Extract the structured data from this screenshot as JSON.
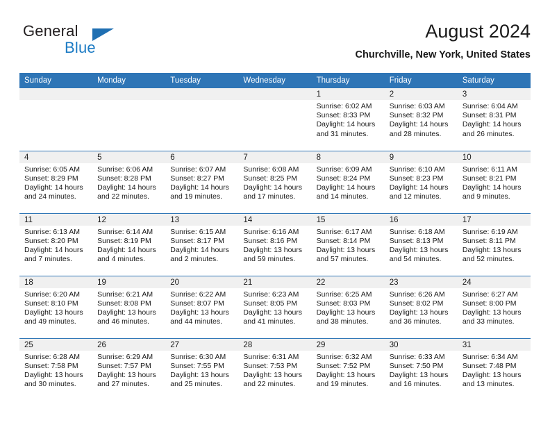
{
  "brand": {
    "name_part1": "General",
    "name_part2": "Blue",
    "accent_color": "#1c7bc4",
    "triangle_color": "#1f6fb2"
  },
  "header": {
    "title": "August 2024",
    "location": "Churchville, New York, United States"
  },
  "theme": {
    "header_blue": "#2e75b6",
    "daynum_band": "#f0f0f0",
    "text": "#1a1a1a"
  },
  "weekdays": [
    "Sunday",
    "Monday",
    "Tuesday",
    "Wednesday",
    "Thursday",
    "Friday",
    "Saturday"
  ],
  "calendar": {
    "weeks": [
      [
        {
          "day": "",
          "empty": true
        },
        {
          "day": "",
          "empty": true
        },
        {
          "day": "",
          "empty": true
        },
        {
          "day": "",
          "empty": true
        },
        {
          "day": "1",
          "sunrise": "Sunrise: 6:02 AM",
          "sunset": "Sunset: 8:33 PM",
          "daylight_1": "Daylight: 14 hours",
          "daylight_2": "and 31 minutes."
        },
        {
          "day": "2",
          "sunrise": "Sunrise: 6:03 AM",
          "sunset": "Sunset: 8:32 PM",
          "daylight_1": "Daylight: 14 hours",
          "daylight_2": "and 28 minutes."
        },
        {
          "day": "3",
          "sunrise": "Sunrise: 6:04 AM",
          "sunset": "Sunset: 8:31 PM",
          "daylight_1": "Daylight: 14 hours",
          "daylight_2": "and 26 minutes."
        }
      ],
      [
        {
          "day": "4",
          "sunrise": "Sunrise: 6:05 AM",
          "sunset": "Sunset: 8:29 PM",
          "daylight_1": "Daylight: 14 hours",
          "daylight_2": "and 24 minutes."
        },
        {
          "day": "5",
          "sunrise": "Sunrise: 6:06 AM",
          "sunset": "Sunset: 8:28 PM",
          "daylight_1": "Daylight: 14 hours",
          "daylight_2": "and 22 minutes."
        },
        {
          "day": "6",
          "sunrise": "Sunrise: 6:07 AM",
          "sunset": "Sunset: 8:27 PM",
          "daylight_1": "Daylight: 14 hours",
          "daylight_2": "and 19 minutes."
        },
        {
          "day": "7",
          "sunrise": "Sunrise: 6:08 AM",
          "sunset": "Sunset: 8:25 PM",
          "daylight_1": "Daylight: 14 hours",
          "daylight_2": "and 17 minutes."
        },
        {
          "day": "8",
          "sunrise": "Sunrise: 6:09 AM",
          "sunset": "Sunset: 8:24 PM",
          "daylight_1": "Daylight: 14 hours",
          "daylight_2": "and 14 minutes."
        },
        {
          "day": "9",
          "sunrise": "Sunrise: 6:10 AM",
          "sunset": "Sunset: 8:23 PM",
          "daylight_1": "Daylight: 14 hours",
          "daylight_2": "and 12 minutes."
        },
        {
          "day": "10",
          "sunrise": "Sunrise: 6:11 AM",
          "sunset": "Sunset: 8:21 PM",
          "daylight_1": "Daylight: 14 hours",
          "daylight_2": "and 9 minutes."
        }
      ],
      [
        {
          "day": "11",
          "sunrise": "Sunrise: 6:13 AM",
          "sunset": "Sunset: 8:20 PM",
          "daylight_1": "Daylight: 14 hours",
          "daylight_2": "and 7 minutes."
        },
        {
          "day": "12",
          "sunrise": "Sunrise: 6:14 AM",
          "sunset": "Sunset: 8:19 PM",
          "daylight_1": "Daylight: 14 hours",
          "daylight_2": "and 4 minutes."
        },
        {
          "day": "13",
          "sunrise": "Sunrise: 6:15 AM",
          "sunset": "Sunset: 8:17 PM",
          "daylight_1": "Daylight: 14 hours",
          "daylight_2": "and 2 minutes."
        },
        {
          "day": "14",
          "sunrise": "Sunrise: 6:16 AM",
          "sunset": "Sunset: 8:16 PM",
          "daylight_1": "Daylight: 13 hours",
          "daylight_2": "and 59 minutes."
        },
        {
          "day": "15",
          "sunrise": "Sunrise: 6:17 AM",
          "sunset": "Sunset: 8:14 PM",
          "daylight_1": "Daylight: 13 hours",
          "daylight_2": "and 57 minutes."
        },
        {
          "day": "16",
          "sunrise": "Sunrise: 6:18 AM",
          "sunset": "Sunset: 8:13 PM",
          "daylight_1": "Daylight: 13 hours",
          "daylight_2": "and 54 minutes."
        },
        {
          "day": "17",
          "sunrise": "Sunrise: 6:19 AM",
          "sunset": "Sunset: 8:11 PM",
          "daylight_1": "Daylight: 13 hours",
          "daylight_2": "and 52 minutes."
        }
      ],
      [
        {
          "day": "18",
          "sunrise": "Sunrise: 6:20 AM",
          "sunset": "Sunset: 8:10 PM",
          "daylight_1": "Daylight: 13 hours",
          "daylight_2": "and 49 minutes."
        },
        {
          "day": "19",
          "sunrise": "Sunrise: 6:21 AM",
          "sunset": "Sunset: 8:08 PM",
          "daylight_1": "Daylight: 13 hours",
          "daylight_2": "and 46 minutes."
        },
        {
          "day": "20",
          "sunrise": "Sunrise: 6:22 AM",
          "sunset": "Sunset: 8:07 PM",
          "daylight_1": "Daylight: 13 hours",
          "daylight_2": "and 44 minutes."
        },
        {
          "day": "21",
          "sunrise": "Sunrise: 6:23 AM",
          "sunset": "Sunset: 8:05 PM",
          "daylight_1": "Daylight: 13 hours",
          "daylight_2": "and 41 minutes."
        },
        {
          "day": "22",
          "sunrise": "Sunrise: 6:25 AM",
          "sunset": "Sunset: 8:03 PM",
          "daylight_1": "Daylight: 13 hours",
          "daylight_2": "and 38 minutes."
        },
        {
          "day": "23",
          "sunrise": "Sunrise: 6:26 AM",
          "sunset": "Sunset: 8:02 PM",
          "daylight_1": "Daylight: 13 hours",
          "daylight_2": "and 36 minutes."
        },
        {
          "day": "24",
          "sunrise": "Sunrise: 6:27 AM",
          "sunset": "Sunset: 8:00 PM",
          "daylight_1": "Daylight: 13 hours",
          "daylight_2": "and 33 minutes."
        }
      ],
      [
        {
          "day": "25",
          "sunrise": "Sunrise: 6:28 AM",
          "sunset": "Sunset: 7:58 PM",
          "daylight_1": "Daylight: 13 hours",
          "daylight_2": "and 30 minutes."
        },
        {
          "day": "26",
          "sunrise": "Sunrise: 6:29 AM",
          "sunset": "Sunset: 7:57 PM",
          "daylight_1": "Daylight: 13 hours",
          "daylight_2": "and 27 minutes."
        },
        {
          "day": "27",
          "sunrise": "Sunrise: 6:30 AM",
          "sunset": "Sunset: 7:55 PM",
          "daylight_1": "Daylight: 13 hours",
          "daylight_2": "and 25 minutes."
        },
        {
          "day": "28",
          "sunrise": "Sunrise: 6:31 AM",
          "sunset": "Sunset: 7:53 PM",
          "daylight_1": "Daylight: 13 hours",
          "daylight_2": "and 22 minutes."
        },
        {
          "day": "29",
          "sunrise": "Sunrise: 6:32 AM",
          "sunset": "Sunset: 7:52 PM",
          "daylight_1": "Daylight: 13 hours",
          "daylight_2": "and 19 minutes."
        },
        {
          "day": "30",
          "sunrise": "Sunrise: 6:33 AM",
          "sunset": "Sunset: 7:50 PM",
          "daylight_1": "Daylight: 13 hours",
          "daylight_2": "and 16 minutes."
        },
        {
          "day": "31",
          "sunrise": "Sunrise: 6:34 AM",
          "sunset": "Sunset: 7:48 PM",
          "daylight_1": "Daylight: 13 hours",
          "daylight_2": "and 13 minutes."
        }
      ]
    ]
  }
}
